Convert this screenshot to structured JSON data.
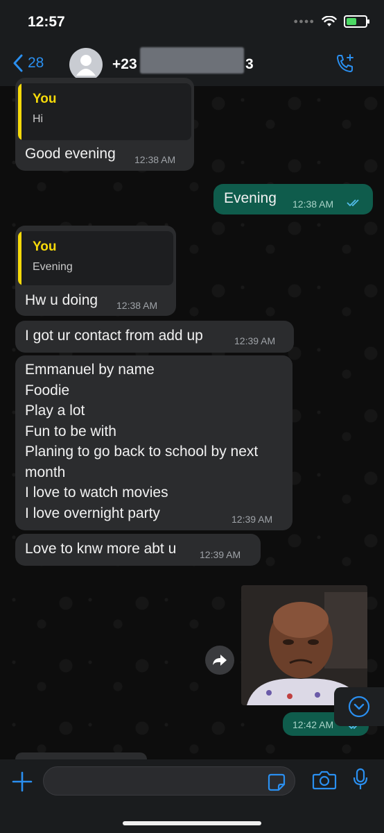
{
  "status_bar": {
    "time": "12:57"
  },
  "header": {
    "back_count": "28",
    "contact_name_start": "+23",
    "contact_name_end": "3"
  },
  "messages": [
    {
      "type": "incoming",
      "quote_author": "You",
      "quote_text": "Hi",
      "text": "Good evening",
      "time": "12:38 AM"
    },
    {
      "type": "outgoing",
      "text": "Evening",
      "time": "12:38 AM",
      "read": true
    },
    {
      "type": "incoming",
      "quote_author": "You",
      "quote_text": "Evening",
      "text": "Hw u doing",
      "time": "12:38 AM"
    },
    {
      "type": "incoming",
      "text": "I got ur contact from add up",
      "time": "12:39 AM"
    },
    {
      "type": "incoming",
      "lines": [
        "Emmanuel by name",
        "Foodie",
        "Play a lot",
        "Fun to be with",
        "Planing to go back to school by next",
        "month",
        "I love to watch movies",
        "I love overnight party"
      ],
      "time": "12:39 AM"
    },
    {
      "type": "incoming",
      "text": "Love to knw more abt u",
      "time": "12:39 AM"
    },
    {
      "type": "outgoing-image",
      "time": "12:42 AM",
      "read": true
    }
  ],
  "colors": {
    "accent": "#2a8ff0",
    "quote_bar": "#f5d90a",
    "outgoing_bubble": "#0f5c4c",
    "incoming_bubble": "#2b2c2e"
  },
  "icons": [
    "chevron-left-icon",
    "add-call-icon",
    "plus-icon",
    "sticker-icon",
    "camera-icon",
    "microphone-icon",
    "forward-icon",
    "scroll-down-icon",
    "read-ticks-icon"
  ]
}
